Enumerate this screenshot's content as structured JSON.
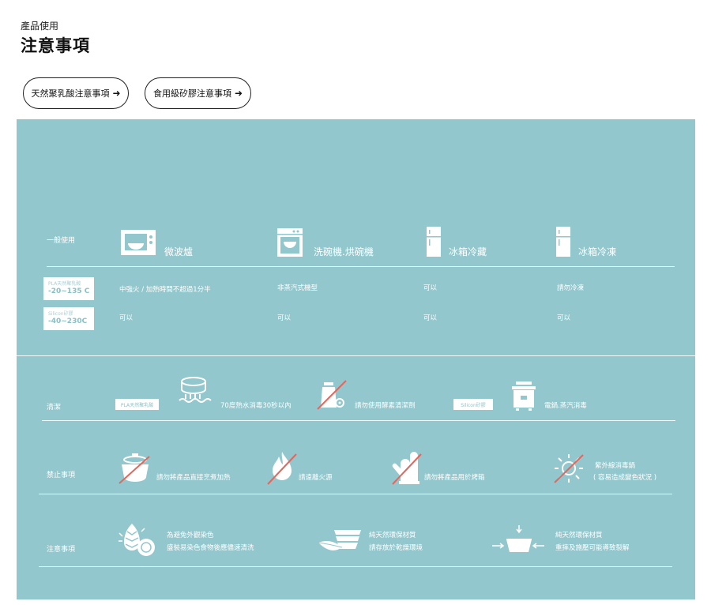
{
  "header": {
    "subtitle": "產品使用",
    "title": "注意事項"
  },
  "buttons": [
    {
      "label": "天然聚乳酸注意事項",
      "arrow": "➜"
    },
    {
      "label": "食用級矽膠注意事項",
      "arrow": "➜"
    }
  ],
  "general": {
    "label": "一般使用",
    "appliances": [
      {
        "label": "微波爐",
        "icon": "microwave-icon"
      },
      {
        "label": "洗碗機.烘碗機",
        "icon": "dishwasher-icon"
      },
      {
        "label": "冰箱冷藏",
        "icon": "fridge-icon"
      },
      {
        "label": "冰箱冷凍",
        "icon": "freezer-icon"
      }
    ],
    "materials": [
      {
        "name": "PLA天然聚乳酸",
        "temp": "-20~135 C",
        "values": [
          "中強火 / 加熱時間不超過1分半",
          "非蒸汽式機型",
          "可以",
          "請勿冷凍"
        ]
      },
      {
        "name": "Silicon矽膠",
        "temp": "-40~230C",
        "values": [
          "可以",
          "可以",
          "可以",
          "可以"
        ]
      }
    ]
  },
  "cleaning": {
    "label": "清潔",
    "pla_tag": "PLA天然聚乳酸",
    "items": [
      "70度熱水消毒30秒以內",
      "請勿使用酵素清潔劑"
    ],
    "silicon_tag": "Silicon矽膠",
    "silicon_item": "電鍋.蒸汽消毒"
  },
  "prohibited": {
    "label": "禁止事項",
    "items": [
      "請勿將產品直接烹煮加熱",
      "請遠離火源",
      "請勿將產品用於烤箱",
      "紫外線消毒鍋",
      "( 容易造成變色狀況 )"
    ]
  },
  "notes": {
    "label": "注意事項",
    "items": [
      {
        "line1": "為避免外觀染色",
        "line2": "盛裝易染色食物後應儘速清洗"
      },
      {
        "line1": "純天然環保材質",
        "line2": "請存放於乾燥環境"
      },
      {
        "line1": "純天然環保材質",
        "line2": "重摔及施壓可能導致裂解"
      }
    ]
  },
  "colors": {
    "panel": "#92c7cd",
    "strike": "#e2675d",
    "text": "#111111",
    "white": "#ffffff"
  }
}
